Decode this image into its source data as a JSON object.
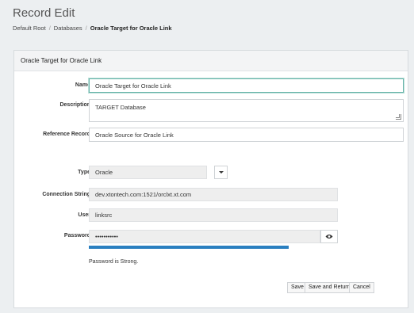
{
  "page": {
    "title": "Record Edit",
    "breadcrumb": [
      "Default Root",
      "Databases",
      "Oracle Target for Oracle Link"
    ]
  },
  "panel": {
    "header": "Oracle Target for Oracle Link"
  },
  "form": {
    "name": {
      "label": "Name",
      "value": "Oracle Target for Oracle Link"
    },
    "description": {
      "label": "Description",
      "value": "TARGET Database"
    },
    "reference_record": {
      "label": "Reference Record",
      "value": "Oracle Source for Oracle Link"
    },
    "type": {
      "label": "Type",
      "value": "Oracle"
    },
    "connection_string": {
      "label": "Connection String",
      "value": "dev.xtontech.com:1521/orclxt.xt.com"
    },
    "user": {
      "label": "User",
      "value": "linksrc"
    },
    "password": {
      "label": "Password",
      "value": "•••••••••••"
    },
    "password_strength": {
      "value": 1.0,
      "text": "Password is Strong."
    }
  },
  "actions": {
    "save": "Save",
    "save_and_return": "Save and Return",
    "cancel": "Cancel"
  },
  "icons": {
    "dropdown": "chevron-down-icon",
    "show_password": "eye-icon"
  },
  "colors": {
    "strength_bar": "#2a7fc0",
    "focus_border": "#66b3a8"
  }
}
